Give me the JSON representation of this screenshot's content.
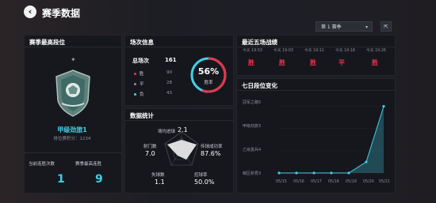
{
  "header": {
    "title": "赛季数据",
    "back_icon": "chevron-left-icon"
  },
  "season_select": {
    "value": "第 1 赛季"
  },
  "best_rank": {
    "title": "赛季最高段位",
    "rank_name": "甲级劲旅1",
    "rank_score": "排位赛积分：1234",
    "stats": [
      {
        "label": "当前连胜次数",
        "value": "1"
      },
      {
        "label": "赛季最高连胜",
        "value": "9"
      }
    ]
  },
  "matches": {
    "title": "场次信息",
    "total_label": "总场次",
    "total": "161",
    "rows": [
      {
        "label": "胜",
        "value": "90",
        "color": "#e8334b"
      },
      {
        "label": "平",
        "value": "28",
        "color": "#8c8f99"
      },
      {
        "label": "负",
        "value": "43",
        "color": "#3fd1e8"
      }
    ],
    "win_rate": "56%",
    "win_rate_label": "胜率",
    "win_rate_value": 0.56
  },
  "stats": {
    "title": "数据统计",
    "items": [
      {
        "label": "场均进球",
        "value": "2.1"
      },
      {
        "label": "传球成功率",
        "value": "87.6%"
      },
      {
        "label": "控球率",
        "value": "50.0%"
      },
      {
        "label": "失球数",
        "value": "1.1"
      },
      {
        "label": "射门数",
        "value": "7.0"
      }
    ]
  },
  "recent": {
    "title": "最近五场战绩",
    "games": [
      {
        "date": "今天 19:53",
        "result": "胜"
      },
      {
        "date": "今天 19:03",
        "result": "胜"
      },
      {
        "date": "今天 19:11",
        "result": "胜"
      },
      {
        "date": "今天 19:18",
        "result": "平"
      },
      {
        "date": "今天 19:26",
        "result": "胜"
      }
    ]
  },
  "rank_change": {
    "title": "七日段位变化",
    "y_labels": [
      "冠军之路5",
      "甲级劲旅3",
      "乙级勇兵4",
      "萌区新秀3"
    ],
    "x_labels": [
      "05/15",
      "05/16",
      "05/17",
      "05/18",
      "05/19",
      "05/20",
      "05/21"
    ],
    "accent": "#3fd1e8"
  },
  "chart_data": {
    "type": "area",
    "title": "七日段位变化",
    "x": [
      "05/15",
      "05/16",
      "05/17",
      "05/18",
      "05/19",
      "05/20",
      "05/21"
    ],
    "y_categories": [
      "萌区新秀3",
      "乙级勇兵4",
      "甲级劲旅3",
      "冠军之路5"
    ],
    "series": [
      {
        "values": [
          0,
          0,
          0,
          0,
          0,
          0.5,
          3.0
        ]
      }
    ],
    "ylim": [
      0,
      3.2
    ]
  }
}
